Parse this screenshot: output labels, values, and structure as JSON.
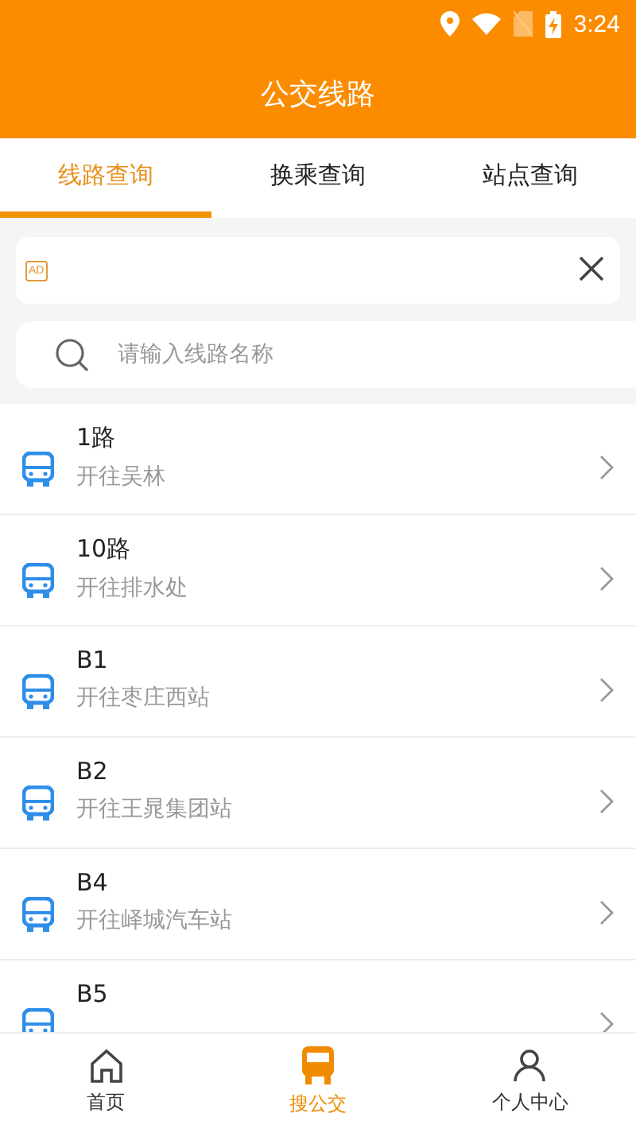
{
  "status_bar": {
    "time": "3:24"
  },
  "header": {
    "title": "公交线路"
  },
  "tabs": [
    {
      "label": "线路查询",
      "selected": true
    },
    {
      "label": "换乘查询",
      "selected": false
    },
    {
      "label": "站点查询",
      "selected": false
    }
  ],
  "ad_banner": {
    "badge": "AD"
  },
  "search": {
    "placeholder": "请输入线路名称"
  },
  "routes": [
    {
      "name": "1路",
      "destination": "开往吴林"
    },
    {
      "name": "10路",
      "destination": "开往排水处"
    },
    {
      "name": "B1",
      "destination": "开往枣庄西站"
    },
    {
      "name": "B2",
      "destination": "开往王晁集团站"
    },
    {
      "name": "B4",
      "destination": "开往峄城汽车站"
    },
    {
      "name": "B5"
    }
  ],
  "bottom_nav": [
    {
      "label": "首页",
      "kind": "home",
      "selected": false
    },
    {
      "label": "搜公交",
      "kind": "bus",
      "selected": true
    },
    {
      "label": "个人中心",
      "kind": "person",
      "selected": false
    }
  ]
}
